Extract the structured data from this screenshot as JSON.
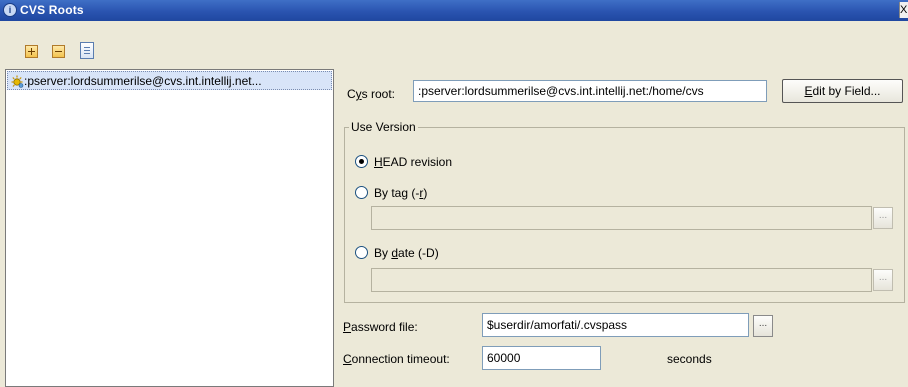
{
  "window": {
    "title": "CVS Roots",
    "close_glyph": "X"
  },
  "toolbar": {
    "add_icon": "plus-icon",
    "remove_icon": "minus-icon",
    "copy_icon": "copy-icon"
  },
  "roots_list": {
    "items": [
      {
        "label": ":pserver:lordsummerilse@cvs.int.intellij.net...",
        "icon": "cvs-root-icon",
        "selected": true
      }
    ]
  },
  "cvs_root": {
    "label_prefix": "C",
    "label_mnemonic": "y",
    "label_suffix": "s root:",
    "value": ":pserver:lordsummerilse@cvs.int.intellij.net:/home/cvs",
    "edit_button_mnemonic": "E",
    "edit_button_rest": "dit by Field..."
  },
  "use_version": {
    "legend": "Use Version",
    "head": {
      "mnemonic": "H",
      "rest": "EAD revision",
      "checked": true
    },
    "by_tag": {
      "before": "By tag (-",
      "mnemonic": "r",
      "after": ")",
      "checked": false,
      "value": "",
      "dots": "..."
    },
    "by_date": {
      "before": "By ",
      "mnemonic": "d",
      "after": "ate (-D)",
      "checked": false,
      "value": "",
      "dots": "..."
    }
  },
  "password_file": {
    "mnemonic": "P",
    "rest": "assword file:",
    "value": "$userdir/amorfati/.cvspass",
    "dots": "..."
  },
  "connection_timeout": {
    "mnemonic": "C",
    "rest": "onnection timeout:",
    "value": "60000",
    "unit": "seconds"
  }
}
